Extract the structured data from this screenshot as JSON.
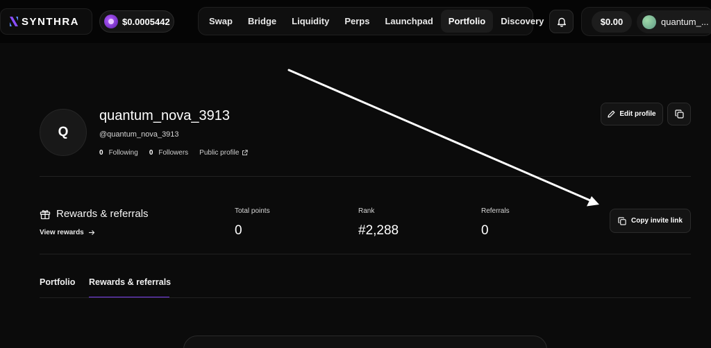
{
  "brand": {
    "name": "SYNTHRA"
  },
  "token": {
    "price": "$0.0005442",
    "icon": "token-coin-icon"
  },
  "nav": {
    "items": [
      {
        "label": "Swap",
        "active": false
      },
      {
        "label": "Bridge",
        "active": false
      },
      {
        "label": "Liquidity",
        "active": false
      },
      {
        "label": "Perps",
        "active": false
      },
      {
        "label": "Launchpad",
        "active": false
      },
      {
        "label": "Portfolio",
        "active": true
      },
      {
        "label": "Discovery",
        "active": false
      }
    ]
  },
  "header": {
    "notification_icon": "bell-icon",
    "balance": "$0.00",
    "username": "quantum_..."
  },
  "profile": {
    "avatar_initial": "Q",
    "display_name": "quantum_nova_3913",
    "handle": "@quantum_nova_3913",
    "following_count": "0",
    "following_label": "Following",
    "followers_count": "0",
    "followers_label": "Followers",
    "public_profile_label": "Public profile",
    "edit_label": "Edit profile"
  },
  "rewards": {
    "title": "Rewards & referrals",
    "view_label": "View rewards",
    "stats": [
      {
        "label": "Total points",
        "value": "0"
      },
      {
        "label": "Rank",
        "value": "#2,288"
      },
      {
        "label": "Referrals",
        "value": "0"
      }
    ],
    "invite_label": "Copy invite link"
  },
  "tabs": [
    {
      "label": "Portfolio",
      "active": false
    },
    {
      "label": "Rewards & referrals",
      "active": true
    }
  ],
  "colors": {
    "accent": "#7a3cf0",
    "background": "#0b0b0b",
    "annotation_arrow": "#ffffff"
  }
}
